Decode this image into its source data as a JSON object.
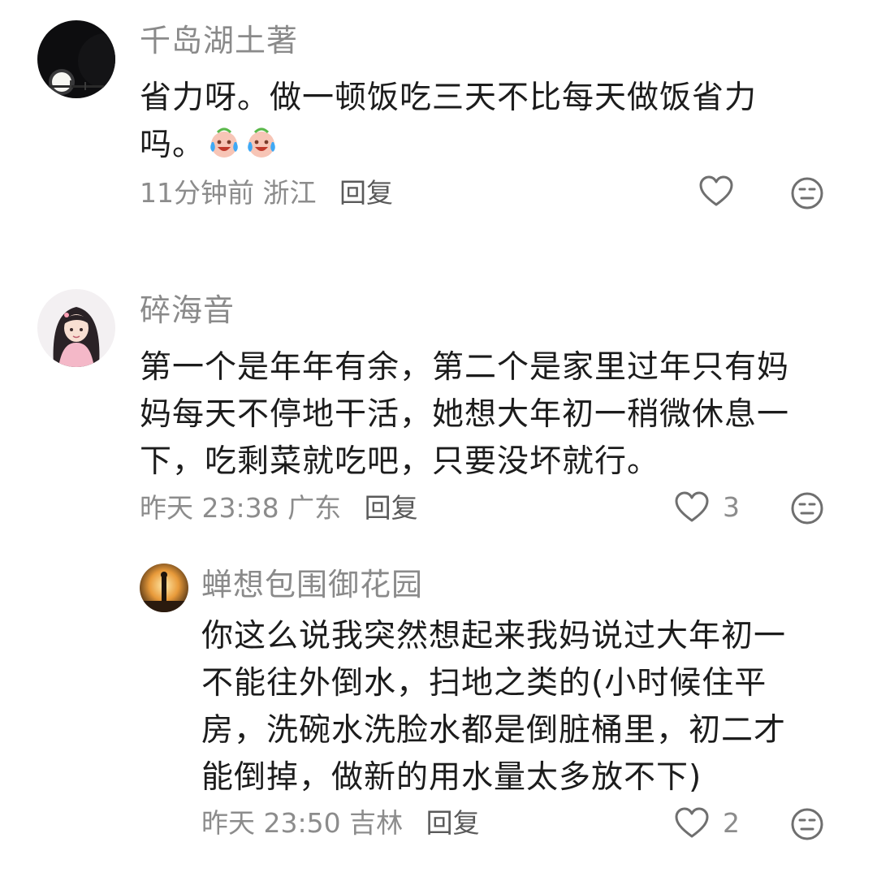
{
  "comments": [
    {
      "username": "千岛湖土著",
      "lines": [
        "省力呀。做一顿饭吃三天不比每天做饭省力",
        "吗。"
      ],
      "emojis": [
        "crying-laugh-emoji",
        "crying-laugh-emoji"
      ],
      "time": "11分钟前",
      "location": "浙江",
      "reply_label": "回复",
      "like_count": ""
    },
    {
      "username": "碎海音",
      "lines": [
        "第一个是年年有余，第二个是家里过年只有妈",
        "妈每天不停地干活，她想大年初一稍微休息一",
        "下，吃剩菜就吃吧，只要没坏就行。"
      ],
      "time": "昨天 23:38",
      "location": "广东",
      "reply_label": "回复",
      "like_count": "3"
    },
    {
      "username": "蝉想包围御花园",
      "lines": [
        "你这么说我突然想起来我妈说过大年初一",
        "不能往外倒水，扫地之类的(小时候住平",
        "房，洗碗水洗脸水都是倒脏桶里，初二才",
        "能倒掉，做新的用水量太多放不下)"
      ],
      "time": "昨天 23:50",
      "location": "吉林",
      "reply_label": "回复",
      "like_count": "2"
    }
  ],
  "icons": {
    "like": "heart-outline-icon",
    "dislike": "neutral-face-icon"
  },
  "colors": {
    "username": "#8a8a8a",
    "text": "#1c1c1c",
    "meta": "#8c8c8c",
    "icon": "#6f6f6f"
  }
}
